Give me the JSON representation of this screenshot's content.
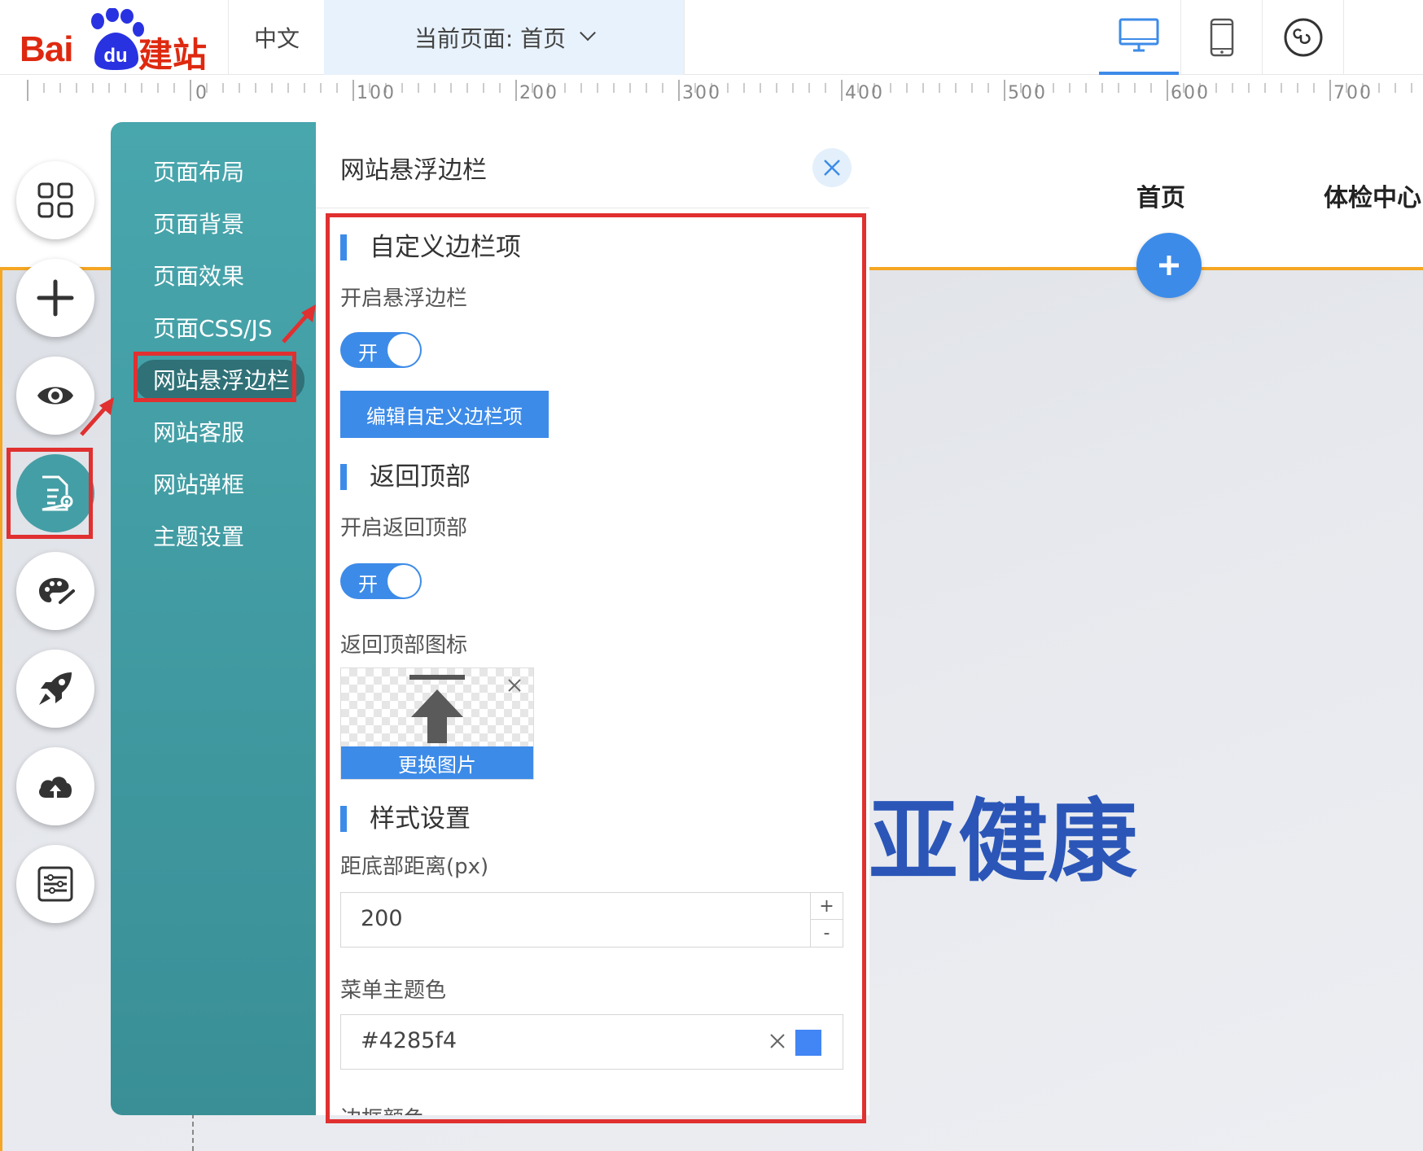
{
  "topbar": {
    "logo": {
      "text_latin": "Bai",
      "text_paw": "du",
      "text_cn": "建站"
    },
    "language": "中文",
    "current_page": "当前页面: 首页",
    "devices": [
      "desktop-icon",
      "mobile-icon",
      "mini-program-icon"
    ]
  },
  "ruler": {
    "labels": [
      "0",
      "100",
      "200",
      "300",
      "400",
      "500",
      "600",
      "700"
    ]
  },
  "canvas": {
    "nav": [
      "首页",
      "体检中心"
    ],
    "hero_title": "亚健康"
  },
  "toolbar": {
    "tools": [
      "grid-icon",
      "add-icon",
      "preview-eye-icon",
      "page-settings-icon",
      "palette-icon",
      "rocket-icon",
      "cloud-upload-icon",
      "sliders-icon"
    ]
  },
  "menu": {
    "items": [
      "页面布局",
      "页面背景",
      "页面效果",
      "页面CSS/JS",
      "网站悬浮边栏",
      "网站客服",
      "网站弹框",
      "主题设置"
    ],
    "active_index": 4
  },
  "panel": {
    "title": "网站悬浮边栏",
    "custom_section": {
      "title": "自定义边栏项",
      "enable_label": "开启悬浮边栏",
      "toggle_text": "开",
      "edit_button": "编辑自定义边栏项"
    },
    "back_to_top_section": {
      "title": "返回顶部",
      "enable_label": "开启返回顶部",
      "toggle_text": "开",
      "icon_label": "返回顶部图标",
      "replace_button": "更换图片"
    },
    "style_section": {
      "title": "样式设置",
      "distance_label": "距底部距离(px)",
      "distance_value": "200",
      "stepper_plus": "+",
      "stepper_minus": "-",
      "theme_color_label": "菜单主题色",
      "theme_color_value": "#4285f4",
      "border_color_label": "边框颜色"
    }
  },
  "colors": {
    "accent": "#3d8be8",
    "menu_teal": "#449ea5",
    "highlight_red": "#e03030",
    "hero_text": "#2b56b8",
    "theme_swatch": "#4285f4"
  }
}
